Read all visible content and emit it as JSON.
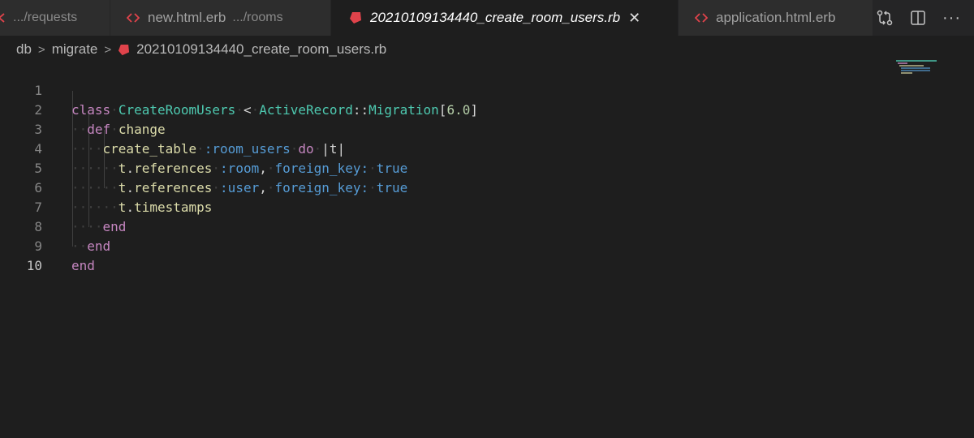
{
  "tabs": [
    {
      "name": "",
      "description": ".../requests",
      "icon": "erb-icon",
      "active": false
    },
    {
      "name": "new.html.erb",
      "description": ".../rooms",
      "icon": "erb-icon",
      "active": false
    },
    {
      "name": "20210109134440_create_room_users.rb",
      "description": "",
      "icon": "ruby-icon",
      "active": true
    },
    {
      "name": "application.html.erb",
      "description": "",
      "icon": "erb-icon",
      "active": false
    }
  ],
  "tab_actions": {
    "more": "···"
  },
  "breadcrumb": [
    "db",
    "migrate",
    "20210109134440_create_room_users.rb"
  ],
  "line_numbers": [
    "1",
    "2",
    "3",
    "4",
    "5",
    "6",
    "7",
    "8",
    "9",
    "10"
  ],
  "code": {
    "l1": {
      "kw_class": "class",
      "class_name": "CreateRoomUsers",
      "op_lt": "<",
      "parent": "ActiveRecord",
      "sep": "::",
      "parent2": "Migration",
      "br_open": "[",
      "version": "6.0",
      "br_close": "]"
    },
    "l2": {
      "kw_def": "def",
      "method": "change"
    },
    "l3": {
      "call": "create_table",
      "sym": ":room_users",
      "kw_do": "do",
      "block": "|t|"
    },
    "l4": {
      "recv": "t",
      "dot": ".",
      "method": "references",
      "sym": ":room",
      "comma": ",",
      "key": "foreign_key:",
      "val": "true"
    },
    "l5": {
      "recv": "t",
      "dot": ".",
      "method": "references",
      "sym": ":user",
      "comma": ",",
      "key": "foreign_key:",
      "val": "true"
    },
    "l6": {
      "recv": "t",
      "dot": ".",
      "method": "timestamps"
    },
    "l7": {
      "kw_end": "end"
    },
    "l8": {
      "kw_end": "end"
    },
    "l9": {
      "kw_end": "end"
    }
  },
  "colors": {
    "editor_bg": "#1e1e1e",
    "keyword": "#c586c0",
    "class": "#4ec9b0",
    "function": "#dcdcaa",
    "symbol": "#569cd6",
    "number": "#b5cea8",
    "ruby_icon": "#e0434b",
    "erb_icon": "#e0434b"
  }
}
